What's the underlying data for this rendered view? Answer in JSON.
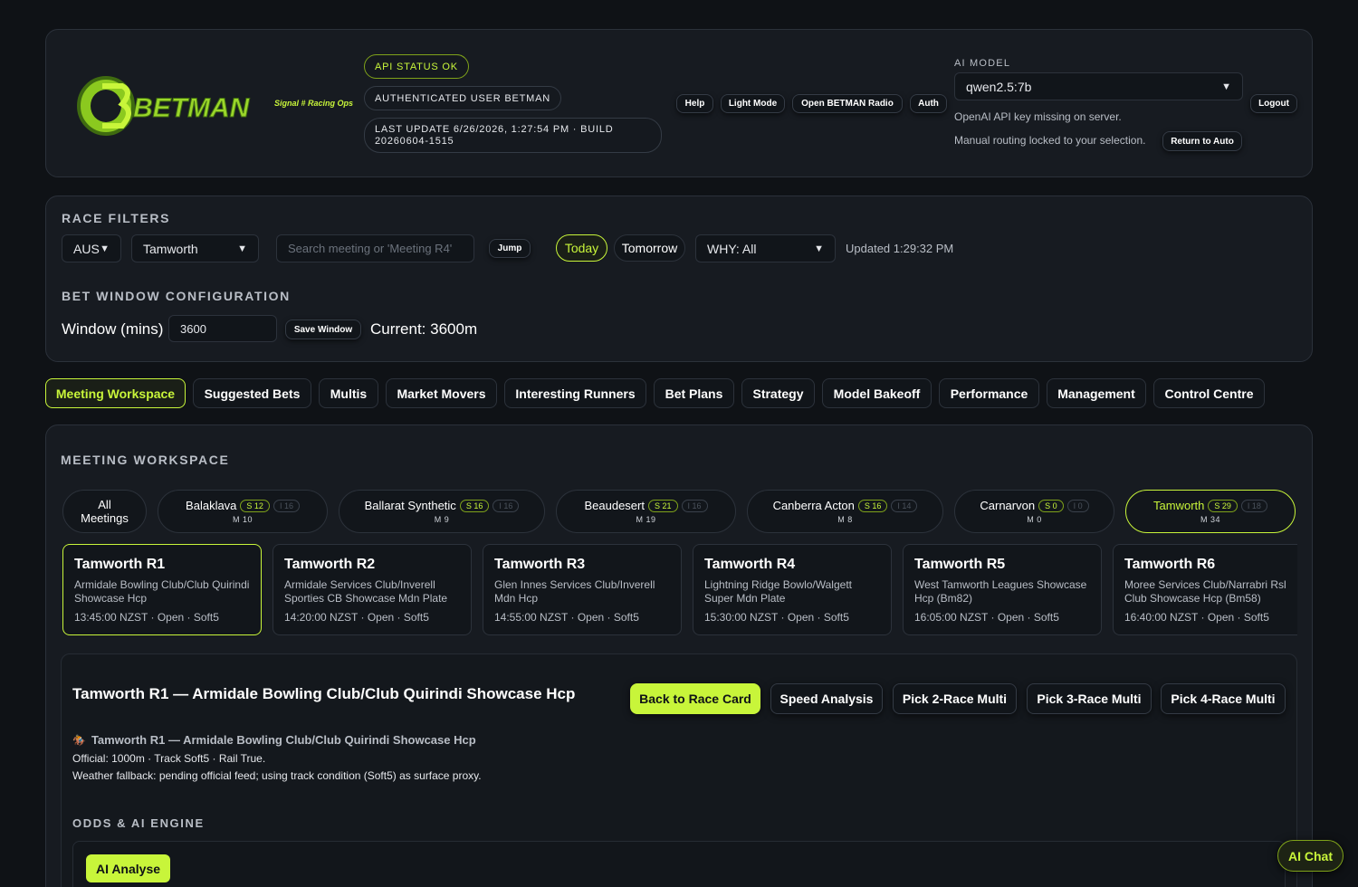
{
  "header": {
    "brand": "BETMAN",
    "tagline": "Signal # Racing Ops",
    "api_status": "API STATUS OK",
    "auth_user": "AUTHENTICATED USER BETMAN",
    "last_update": "LAST UPDATE 6/26/2026, 1:27:54 PM · BUILD 20260604-1515",
    "buttons": {
      "help": "Help",
      "light_mode": "Light Mode",
      "radio": "Open BETMAN Radio",
      "auth": "Auth",
      "logout": "Logout"
    },
    "ai_model_label": "AI MODEL",
    "ai_model_value": "qwen2.5:7b",
    "api_key_msg": "OpenAI API key missing on server.",
    "routing_msg": "Manual routing locked to your selection.",
    "return_auto": "Return to Auto"
  },
  "filters": {
    "label": "RACE FILTERS",
    "country": "AUS",
    "meeting": "Tamworth",
    "search_placeholder": "Search meeting or 'Meeting R4'",
    "jump": "Jump",
    "today": "Today",
    "tomorrow": "Tomorrow",
    "why": "WHY: All",
    "updated": "Updated 1:29:32 PM"
  },
  "bet_window": {
    "label": "BET WINDOW CONFIGURATION",
    "window_label": "Window (mins)",
    "window_value": "3600",
    "save": "Save Window",
    "current": "Current: 3600m"
  },
  "tabs": [
    "Meeting Workspace",
    "Suggested Bets",
    "Multis",
    "Market Movers",
    "Interesting Runners",
    "Bet Plans",
    "Strategy",
    "Model Bakeoff",
    "Performance",
    "Management",
    "Control Centre"
  ],
  "workspace": {
    "label": "MEETING WORKSPACE",
    "all_meetings_1": "All",
    "all_meetings_2": "Meetings",
    "meetings": [
      {
        "name": "Balaklava",
        "s": "S 12",
        "i": "I 16",
        "m": "M 10"
      },
      {
        "name": "Ballarat Synthetic",
        "s": "S 16",
        "i": "I 16",
        "m": "M 9"
      },
      {
        "name": "Beaudesert",
        "s": "S 21",
        "i": "I 16",
        "m": "M 19"
      },
      {
        "name": "Canberra Acton",
        "s": "S 16",
        "i": "I 14",
        "m": "M 8"
      },
      {
        "name": "Carnarvon",
        "s": "S 0",
        "i": "I 0",
        "m": "M 0"
      },
      {
        "name": "Tamworth",
        "s": "S 29",
        "i": "I 18",
        "m": "M 34"
      }
    ],
    "races": [
      {
        "title": "Tamworth R1",
        "name": "Armidale Bowling Club/Club Quirindi Showcase Hcp",
        "meta": "13:45:00 NZST · Open · Soft5"
      },
      {
        "title": "Tamworth R2",
        "name": "Armidale Services Club/Inverell Sporties CB Showcase Mdn Plate",
        "meta": "14:20:00 NZST · Open · Soft5"
      },
      {
        "title": "Tamworth R3",
        "name": "Glen Innes Services Club/Inverell Mdn Hcp",
        "meta": "14:55:00 NZST · Open · Soft5"
      },
      {
        "title": "Tamworth R4",
        "name": "Lightning Ridge Bowlo/Walgett Super Mdn Plate",
        "meta": "15:30:00 NZST · Open · Soft5"
      },
      {
        "title": "Tamworth R5",
        "name": "West Tamworth Leagues Showcase Hcp (Bm82)",
        "meta": "16:05:00 NZST · Open · Soft5"
      },
      {
        "title": "Tamworth R6",
        "name": "Moree Services Club/Narrabri Rsl Club Showcase Hcp (Bm58)",
        "meta": "16:40:00 NZST · Open · Soft5"
      }
    ]
  },
  "detail": {
    "title": "Tamworth R1 — Armidale Bowling Club/Club Quirindi Showcase Hcp",
    "buttons": {
      "back": "Back to Race Card",
      "speed": "Speed Analysis",
      "pick2": "Pick 2-Race Multi",
      "pick3": "Pick 3-Race Multi",
      "pick4": "Pick 4-Race Multi"
    },
    "subtitle": "Tamworth R1 — Armidale Bowling Club/Club Quirindi Showcase Hcp",
    "official": "Official: 1000m · Track Soft5 · Rail True.",
    "weather": "Weather fallback: pending official feed; using track condition (Soft5) as surface proxy.",
    "odds_label": "ODDS & AI ENGINE",
    "ai_analyse": "AI Analyse"
  },
  "ai_chat": "AI Chat",
  "colors": {
    "accent": "#c8f53a",
    "bg": "#0f1216",
    "card": "#171b21"
  }
}
